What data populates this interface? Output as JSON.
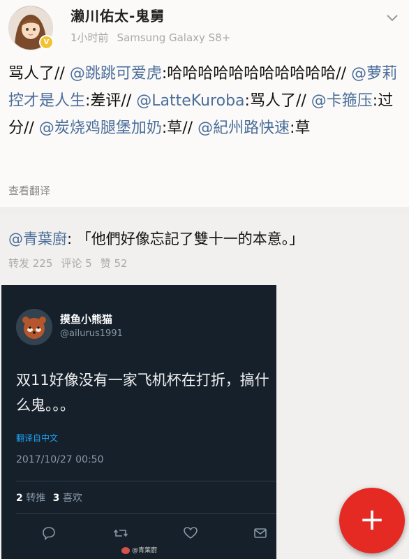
{
  "post": {
    "username": "濑川佑太-鬼舅",
    "time": "1小时前",
    "device": "Samsung Galaxy S8+",
    "badge": "V",
    "body_segments": [
      {
        "text": "骂人了// ",
        "mention": false
      },
      {
        "text": "@跳跳可爱虎",
        "mention": true
      },
      {
        "text": ":哈哈哈哈哈哈哈哈哈哈哈// ",
        "mention": false
      },
      {
        "text": "@萝莉控才是人生",
        "mention": true
      },
      {
        "text": ":差评// ",
        "mention": false
      },
      {
        "text": "@LatteKuroba",
        "mention": true
      },
      {
        "text": ":骂人了// ",
        "mention": false
      },
      {
        "text": "@卡箍压",
        "mention": true
      },
      {
        "text": ":过分// ",
        "mention": false
      },
      {
        "text": "@炭烧鸡腿堡加奶",
        "mention": true
      },
      {
        "text": ":草// ",
        "mention": false
      },
      {
        "text": "@紀州路快速",
        "mention": true
      },
      {
        "text": ":草",
        "mention": false
      }
    ],
    "translate_label": "查看翻译"
  },
  "quote": {
    "mention": "@青葉廚",
    "text": ": 「他們好像忘記了雙十一的本意。」",
    "stats": {
      "repost": "转发 225",
      "comment": "评论 5",
      "like": "赞 52"
    }
  },
  "tweet": {
    "name": "摸鱼小熊猫",
    "handle": "@ailurus1991",
    "text": "双11好像没有一家飞机杯在打折，搞什么鬼。。。",
    "translate_label": "翻译自中文",
    "date": "2017/10/27 00:50",
    "retweets_count": "2",
    "retweets_label": "转推",
    "likes_count": "3",
    "likes_label": "喜欢",
    "watermark": "@青葉廚"
  },
  "fab": {
    "label": "+"
  },
  "colors": {
    "mention": "#4a6e9b",
    "tweet_bg": "#15202b",
    "fab": "#e52a24"
  }
}
